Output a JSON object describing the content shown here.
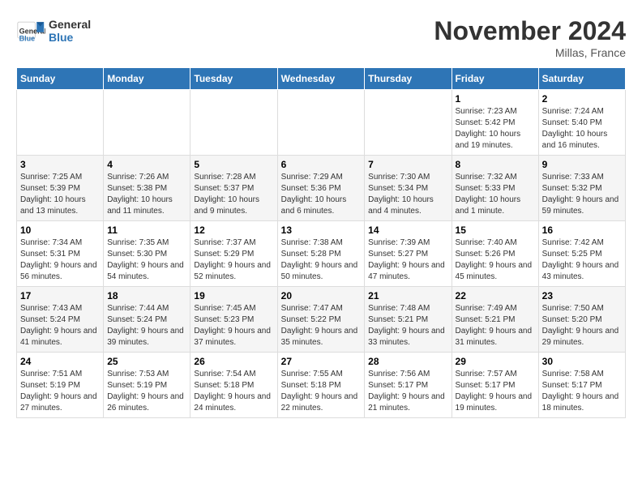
{
  "logo": {
    "text_general": "General",
    "text_blue": "Blue"
  },
  "title": "November 2024",
  "location": "Millas, France",
  "days_of_week": [
    "Sunday",
    "Monday",
    "Tuesday",
    "Wednesday",
    "Thursday",
    "Friday",
    "Saturday"
  ],
  "weeks": [
    [
      {
        "day": "",
        "info": ""
      },
      {
        "day": "",
        "info": ""
      },
      {
        "day": "",
        "info": ""
      },
      {
        "day": "",
        "info": ""
      },
      {
        "day": "",
        "info": ""
      },
      {
        "day": "1",
        "info": "Sunrise: 7:23 AM\nSunset: 5:42 PM\nDaylight: 10 hours and 19 minutes."
      },
      {
        "day": "2",
        "info": "Sunrise: 7:24 AM\nSunset: 5:40 PM\nDaylight: 10 hours and 16 minutes."
      }
    ],
    [
      {
        "day": "3",
        "info": "Sunrise: 7:25 AM\nSunset: 5:39 PM\nDaylight: 10 hours and 13 minutes."
      },
      {
        "day": "4",
        "info": "Sunrise: 7:26 AM\nSunset: 5:38 PM\nDaylight: 10 hours and 11 minutes."
      },
      {
        "day": "5",
        "info": "Sunrise: 7:28 AM\nSunset: 5:37 PM\nDaylight: 10 hours and 9 minutes."
      },
      {
        "day": "6",
        "info": "Sunrise: 7:29 AM\nSunset: 5:36 PM\nDaylight: 10 hours and 6 minutes."
      },
      {
        "day": "7",
        "info": "Sunrise: 7:30 AM\nSunset: 5:34 PM\nDaylight: 10 hours and 4 minutes."
      },
      {
        "day": "8",
        "info": "Sunrise: 7:32 AM\nSunset: 5:33 PM\nDaylight: 10 hours and 1 minute."
      },
      {
        "day": "9",
        "info": "Sunrise: 7:33 AM\nSunset: 5:32 PM\nDaylight: 9 hours and 59 minutes."
      }
    ],
    [
      {
        "day": "10",
        "info": "Sunrise: 7:34 AM\nSunset: 5:31 PM\nDaylight: 9 hours and 56 minutes."
      },
      {
        "day": "11",
        "info": "Sunrise: 7:35 AM\nSunset: 5:30 PM\nDaylight: 9 hours and 54 minutes."
      },
      {
        "day": "12",
        "info": "Sunrise: 7:37 AM\nSunset: 5:29 PM\nDaylight: 9 hours and 52 minutes."
      },
      {
        "day": "13",
        "info": "Sunrise: 7:38 AM\nSunset: 5:28 PM\nDaylight: 9 hours and 50 minutes."
      },
      {
        "day": "14",
        "info": "Sunrise: 7:39 AM\nSunset: 5:27 PM\nDaylight: 9 hours and 47 minutes."
      },
      {
        "day": "15",
        "info": "Sunrise: 7:40 AM\nSunset: 5:26 PM\nDaylight: 9 hours and 45 minutes."
      },
      {
        "day": "16",
        "info": "Sunrise: 7:42 AM\nSunset: 5:25 PM\nDaylight: 9 hours and 43 minutes."
      }
    ],
    [
      {
        "day": "17",
        "info": "Sunrise: 7:43 AM\nSunset: 5:24 PM\nDaylight: 9 hours and 41 minutes."
      },
      {
        "day": "18",
        "info": "Sunrise: 7:44 AM\nSunset: 5:24 PM\nDaylight: 9 hours and 39 minutes."
      },
      {
        "day": "19",
        "info": "Sunrise: 7:45 AM\nSunset: 5:23 PM\nDaylight: 9 hours and 37 minutes."
      },
      {
        "day": "20",
        "info": "Sunrise: 7:47 AM\nSunset: 5:22 PM\nDaylight: 9 hours and 35 minutes."
      },
      {
        "day": "21",
        "info": "Sunrise: 7:48 AM\nSunset: 5:21 PM\nDaylight: 9 hours and 33 minutes."
      },
      {
        "day": "22",
        "info": "Sunrise: 7:49 AM\nSunset: 5:21 PM\nDaylight: 9 hours and 31 minutes."
      },
      {
        "day": "23",
        "info": "Sunrise: 7:50 AM\nSunset: 5:20 PM\nDaylight: 9 hours and 29 minutes."
      }
    ],
    [
      {
        "day": "24",
        "info": "Sunrise: 7:51 AM\nSunset: 5:19 PM\nDaylight: 9 hours and 27 minutes."
      },
      {
        "day": "25",
        "info": "Sunrise: 7:53 AM\nSunset: 5:19 PM\nDaylight: 9 hours and 26 minutes."
      },
      {
        "day": "26",
        "info": "Sunrise: 7:54 AM\nSunset: 5:18 PM\nDaylight: 9 hours and 24 minutes."
      },
      {
        "day": "27",
        "info": "Sunrise: 7:55 AM\nSunset: 5:18 PM\nDaylight: 9 hours and 22 minutes."
      },
      {
        "day": "28",
        "info": "Sunrise: 7:56 AM\nSunset: 5:17 PM\nDaylight: 9 hours and 21 minutes."
      },
      {
        "day": "29",
        "info": "Sunrise: 7:57 AM\nSunset: 5:17 PM\nDaylight: 9 hours and 19 minutes."
      },
      {
        "day": "30",
        "info": "Sunrise: 7:58 AM\nSunset: 5:17 PM\nDaylight: 9 hours and 18 minutes."
      }
    ]
  ]
}
